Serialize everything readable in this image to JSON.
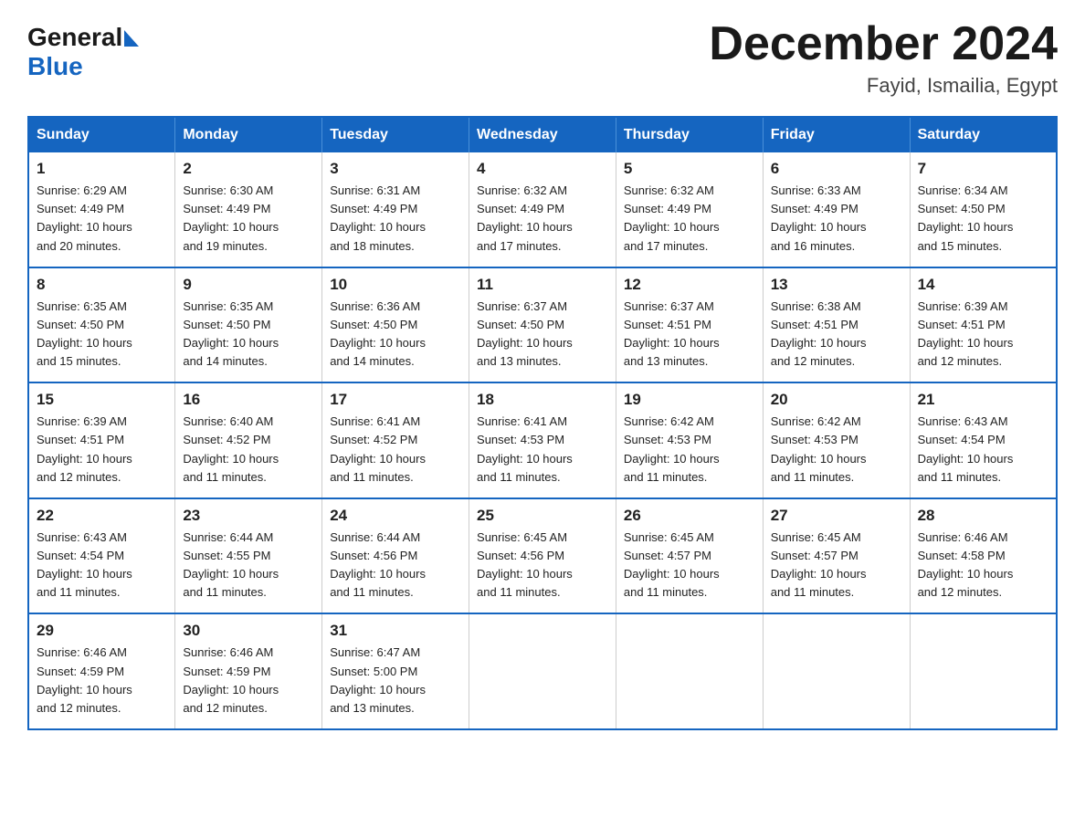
{
  "logo": {
    "general": "General",
    "blue": "Blue"
  },
  "title": "December 2024",
  "location": "Fayid, Ismailia, Egypt",
  "days_of_week": [
    "Sunday",
    "Monday",
    "Tuesday",
    "Wednesday",
    "Thursday",
    "Friday",
    "Saturday"
  ],
  "weeks": [
    [
      {
        "day": "1",
        "sunrise": "6:29 AM",
        "sunset": "4:49 PM",
        "daylight": "10 hours and 20 minutes."
      },
      {
        "day": "2",
        "sunrise": "6:30 AM",
        "sunset": "4:49 PM",
        "daylight": "10 hours and 19 minutes."
      },
      {
        "day": "3",
        "sunrise": "6:31 AM",
        "sunset": "4:49 PM",
        "daylight": "10 hours and 18 minutes."
      },
      {
        "day": "4",
        "sunrise": "6:32 AM",
        "sunset": "4:49 PM",
        "daylight": "10 hours and 17 minutes."
      },
      {
        "day": "5",
        "sunrise": "6:32 AM",
        "sunset": "4:49 PM",
        "daylight": "10 hours and 17 minutes."
      },
      {
        "day": "6",
        "sunrise": "6:33 AM",
        "sunset": "4:49 PM",
        "daylight": "10 hours and 16 minutes."
      },
      {
        "day": "7",
        "sunrise": "6:34 AM",
        "sunset": "4:50 PM",
        "daylight": "10 hours and 15 minutes."
      }
    ],
    [
      {
        "day": "8",
        "sunrise": "6:35 AM",
        "sunset": "4:50 PM",
        "daylight": "10 hours and 15 minutes."
      },
      {
        "day": "9",
        "sunrise": "6:35 AM",
        "sunset": "4:50 PM",
        "daylight": "10 hours and 14 minutes."
      },
      {
        "day": "10",
        "sunrise": "6:36 AM",
        "sunset": "4:50 PM",
        "daylight": "10 hours and 14 minutes."
      },
      {
        "day": "11",
        "sunrise": "6:37 AM",
        "sunset": "4:50 PM",
        "daylight": "10 hours and 13 minutes."
      },
      {
        "day": "12",
        "sunrise": "6:37 AM",
        "sunset": "4:51 PM",
        "daylight": "10 hours and 13 minutes."
      },
      {
        "day": "13",
        "sunrise": "6:38 AM",
        "sunset": "4:51 PM",
        "daylight": "10 hours and 12 minutes."
      },
      {
        "day": "14",
        "sunrise": "6:39 AM",
        "sunset": "4:51 PM",
        "daylight": "10 hours and 12 minutes."
      }
    ],
    [
      {
        "day": "15",
        "sunrise": "6:39 AM",
        "sunset": "4:51 PM",
        "daylight": "10 hours and 12 minutes."
      },
      {
        "day": "16",
        "sunrise": "6:40 AM",
        "sunset": "4:52 PM",
        "daylight": "10 hours and 11 minutes."
      },
      {
        "day": "17",
        "sunrise": "6:41 AM",
        "sunset": "4:52 PM",
        "daylight": "10 hours and 11 minutes."
      },
      {
        "day": "18",
        "sunrise": "6:41 AM",
        "sunset": "4:53 PM",
        "daylight": "10 hours and 11 minutes."
      },
      {
        "day": "19",
        "sunrise": "6:42 AM",
        "sunset": "4:53 PM",
        "daylight": "10 hours and 11 minutes."
      },
      {
        "day": "20",
        "sunrise": "6:42 AM",
        "sunset": "4:53 PM",
        "daylight": "10 hours and 11 minutes."
      },
      {
        "day": "21",
        "sunrise": "6:43 AM",
        "sunset": "4:54 PM",
        "daylight": "10 hours and 11 minutes."
      }
    ],
    [
      {
        "day": "22",
        "sunrise": "6:43 AM",
        "sunset": "4:54 PM",
        "daylight": "10 hours and 11 minutes."
      },
      {
        "day": "23",
        "sunrise": "6:44 AM",
        "sunset": "4:55 PM",
        "daylight": "10 hours and 11 minutes."
      },
      {
        "day": "24",
        "sunrise": "6:44 AM",
        "sunset": "4:56 PM",
        "daylight": "10 hours and 11 minutes."
      },
      {
        "day": "25",
        "sunrise": "6:45 AM",
        "sunset": "4:56 PM",
        "daylight": "10 hours and 11 minutes."
      },
      {
        "day": "26",
        "sunrise": "6:45 AM",
        "sunset": "4:57 PM",
        "daylight": "10 hours and 11 minutes."
      },
      {
        "day": "27",
        "sunrise": "6:45 AM",
        "sunset": "4:57 PM",
        "daylight": "10 hours and 11 minutes."
      },
      {
        "day": "28",
        "sunrise": "6:46 AM",
        "sunset": "4:58 PM",
        "daylight": "10 hours and 12 minutes."
      }
    ],
    [
      {
        "day": "29",
        "sunrise": "6:46 AM",
        "sunset": "4:59 PM",
        "daylight": "10 hours and 12 minutes."
      },
      {
        "day": "30",
        "sunrise": "6:46 AM",
        "sunset": "4:59 PM",
        "daylight": "10 hours and 12 minutes."
      },
      {
        "day": "31",
        "sunrise": "6:47 AM",
        "sunset": "5:00 PM",
        "daylight": "10 hours and 13 minutes."
      },
      null,
      null,
      null,
      null
    ]
  ],
  "labels": {
    "sunrise": "Sunrise:",
    "sunset": "Sunset:",
    "daylight": "Daylight:"
  }
}
